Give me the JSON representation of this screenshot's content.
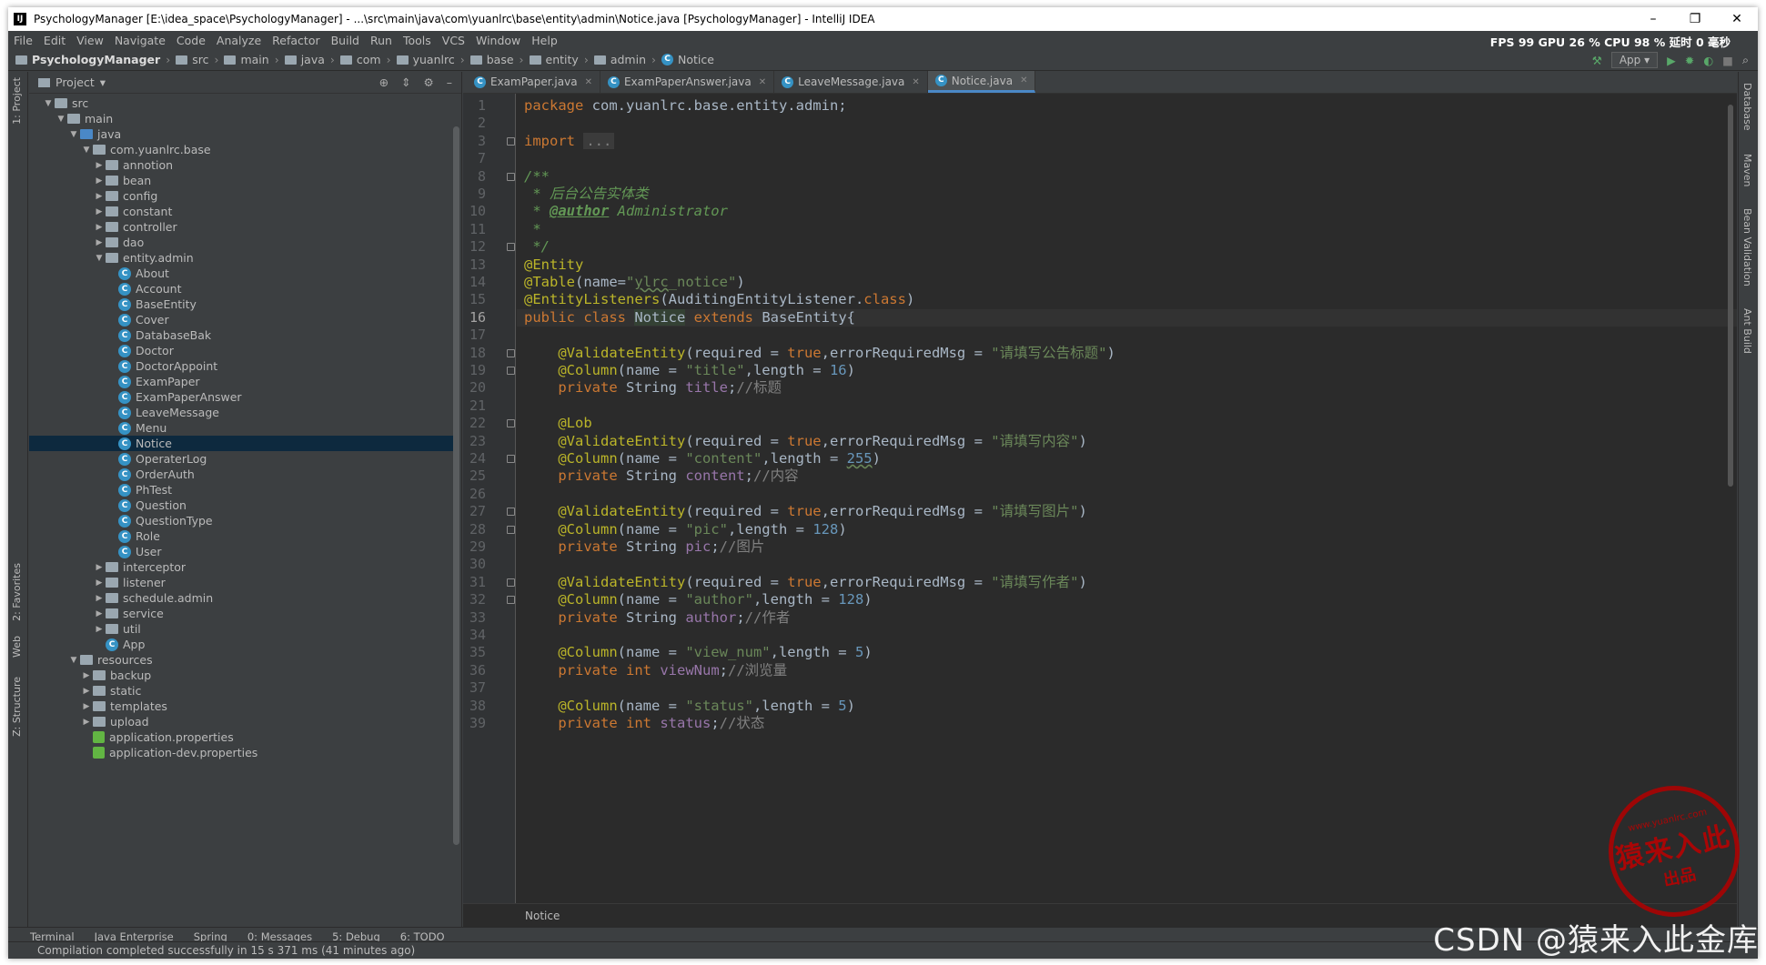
{
  "window": {
    "title": "PsychologyManager [E:\\idea_space\\PsychologyManager] - ...\\src\\main\\java\\com\\yuanlrc\\base\\entity\\admin\\Notice.java [PsychologyManager] - IntelliJ IDEA",
    "minimize": "–",
    "maximize": "❐",
    "close": "✕"
  },
  "menu": [
    "File",
    "Edit",
    "View",
    "Navigate",
    "Code",
    "Analyze",
    "Refactor",
    "Build",
    "Run",
    "Tools",
    "VCS",
    "Window",
    "Help"
  ],
  "perf": "FPS  99   GPU  26 %  CPU  98 %  延时  0 毫秒",
  "breadcrumb": [
    "PsychologyManager",
    "src",
    "main",
    "java",
    "com",
    "yuanlrc",
    "base",
    "entity",
    "admin",
    "Notice"
  ],
  "run_config": "App",
  "left_tools": [
    "1: Project",
    "2: Favorites",
    "Web",
    "Z: Structure"
  ],
  "right_tools": [
    "Database",
    "Maven",
    "Bean Validation",
    "Ant Build"
  ],
  "project_panel": {
    "title": "Project",
    "tree": [
      {
        "label": "src",
        "depth": 1,
        "kind": "folder",
        "open": true
      },
      {
        "label": "main",
        "depth": 2,
        "kind": "folder",
        "open": true
      },
      {
        "label": "java",
        "depth": 3,
        "kind": "blue",
        "open": true
      },
      {
        "label": "com.yuanlrc.base",
        "depth": 4,
        "kind": "folder",
        "open": true
      },
      {
        "label": "annotion",
        "depth": 5,
        "kind": "folder",
        "open": false
      },
      {
        "label": "bean",
        "depth": 5,
        "kind": "folder",
        "open": false
      },
      {
        "label": "config",
        "depth": 5,
        "kind": "folder",
        "open": false
      },
      {
        "label": "constant",
        "depth": 5,
        "kind": "folder",
        "open": false
      },
      {
        "label": "controller",
        "depth": 5,
        "kind": "folder",
        "open": false
      },
      {
        "label": "dao",
        "depth": 5,
        "kind": "folder",
        "open": false
      },
      {
        "label": "entity.admin",
        "depth": 5,
        "kind": "folder",
        "open": true
      },
      {
        "label": "About",
        "depth": 6,
        "kind": "class"
      },
      {
        "label": "Account",
        "depth": 6,
        "kind": "class"
      },
      {
        "label": "BaseEntity",
        "depth": 6,
        "kind": "class"
      },
      {
        "label": "Cover",
        "depth": 6,
        "kind": "class"
      },
      {
        "label": "DatabaseBak",
        "depth": 6,
        "kind": "class"
      },
      {
        "label": "Doctor",
        "depth": 6,
        "kind": "class"
      },
      {
        "label": "DoctorAppoint",
        "depth": 6,
        "kind": "class"
      },
      {
        "label": "ExamPaper",
        "depth": 6,
        "kind": "class"
      },
      {
        "label": "ExamPaperAnswer",
        "depth": 6,
        "kind": "class"
      },
      {
        "label": "LeaveMessage",
        "depth": 6,
        "kind": "class"
      },
      {
        "label": "Menu",
        "depth": 6,
        "kind": "class"
      },
      {
        "label": "Notice",
        "depth": 6,
        "kind": "class",
        "selected": true
      },
      {
        "label": "OperaterLog",
        "depth": 6,
        "kind": "class"
      },
      {
        "label": "OrderAuth",
        "depth": 6,
        "kind": "class"
      },
      {
        "label": "PhTest",
        "depth": 6,
        "kind": "class"
      },
      {
        "label": "Question",
        "depth": 6,
        "kind": "class"
      },
      {
        "label": "QuestionType",
        "depth": 6,
        "kind": "class"
      },
      {
        "label": "Role",
        "depth": 6,
        "kind": "class"
      },
      {
        "label": "User",
        "depth": 6,
        "kind": "class"
      },
      {
        "label": "interceptor",
        "depth": 5,
        "kind": "folder",
        "open": false
      },
      {
        "label": "listener",
        "depth": 5,
        "kind": "folder",
        "open": false
      },
      {
        "label": "schedule.admin",
        "depth": 5,
        "kind": "folder",
        "open": false
      },
      {
        "label": "service",
        "depth": 5,
        "kind": "folder",
        "open": false
      },
      {
        "label": "util",
        "depth": 5,
        "kind": "folder",
        "open": false
      },
      {
        "label": "App",
        "depth": 5,
        "kind": "class"
      },
      {
        "label": "resources",
        "depth": 3,
        "kind": "folder",
        "open": true
      },
      {
        "label": "backup",
        "depth": 4,
        "kind": "folder",
        "open": false
      },
      {
        "label": "static",
        "depth": 4,
        "kind": "folder",
        "open": false
      },
      {
        "label": "templates",
        "depth": 4,
        "kind": "folder",
        "open": false
      },
      {
        "label": "upload",
        "depth": 4,
        "kind": "folder",
        "open": false
      },
      {
        "label": "application.properties",
        "depth": 4,
        "kind": "prop"
      },
      {
        "label": "application-dev.properties",
        "depth": 4,
        "kind": "prop"
      }
    ]
  },
  "tabs": [
    {
      "label": "ExamPaper.java",
      "active": false
    },
    {
      "label": "ExamPaperAnswer.java",
      "active": false
    },
    {
      "label": "LeaveMessage.java",
      "active": false
    },
    {
      "label": "Notice.java",
      "active": true
    }
  ],
  "code_lines": [
    {
      "n": "1",
      "html": "<span class='kw'>package</span> com.yuanlrc.base.entity.admin;"
    },
    {
      "n": "2",
      "html": ""
    },
    {
      "n": "3",
      "html": "<span class='kw'>import</span> <span class='dots'>...</span>",
      "fold": true
    },
    {
      "n": "7",
      "html": ""
    },
    {
      "n": "8",
      "html": "<span class='cm'>/**</span>",
      "fold": true
    },
    {
      "n": "9",
      "html": "<span class='cm'> * 后台公告实体类</span>"
    },
    {
      "n": "10",
      "html": "<span class='cm'> * <span class='tag'>@author</span> Administrator</span>"
    },
    {
      "n": "11",
      "html": "<span class='cm'> *</span>"
    },
    {
      "n": "12",
      "html": "<span class='cm'> */</span>",
      "fold": true
    },
    {
      "n": "13",
      "html": "<span class='an'>@Entity</span>"
    },
    {
      "n": "14",
      "html": "<span class='an'>@Table</span>(name=<span class='st'>\"<span class='sq'>ylrc</span>_notice\"</span>)"
    },
    {
      "n": "15",
      "html": "<span class='an'>@EntityListeners</span>(AuditingEntityListener.<span class='kw'>class</span>)"
    },
    {
      "n": "16",
      "html": "<span class='kw'>public class</span> <span class='hl'>Notice</span> <span class='kw'>extends</span> BaseEntity{",
      "current": true
    },
    {
      "n": "17",
      "html": ""
    },
    {
      "n": "18",
      "html": "    <span class='an'>@ValidateEntity</span>(required = <span class='kw'>true</span>,errorRequiredMsg = <span class='st'>\"请填写公告标题\"</span>)",
      "fold": true
    },
    {
      "n": "19",
      "html": "    <span class='an'>@Column</span>(name = <span class='st'>\"title\"</span>,length = <span class='nm'>16</span>)",
      "fold": true
    },
    {
      "n": "20",
      "html": "    <span class='kw'>private</span> String <span class='fd'>title</span>;<span class='cg'>//标题</span>"
    },
    {
      "n": "21",
      "html": ""
    },
    {
      "n": "22",
      "html": "    <span class='an'>@Lob</span>",
      "fold": true
    },
    {
      "n": "23",
      "html": "    <span class='an'>@ValidateEntity</span>(required = <span class='kw'>true</span>,errorRequiredMsg = <span class='st'>\"请填写内容\"</span>)"
    },
    {
      "n": "24",
      "html": "    <span class='an'>@Column</span>(name = <span class='st'>\"content\"</span>,length = <span class='nm sq'>255</span>)",
      "fold": true
    },
    {
      "n": "25",
      "html": "    <span class='kw'>private</span> String <span class='fd'>content</span>;<span class='cg'>//内容</span>"
    },
    {
      "n": "26",
      "html": ""
    },
    {
      "n": "27",
      "html": "    <span class='an'>@ValidateEntity</span>(required = <span class='kw'>true</span>,errorRequiredMsg = <span class='st'>\"请填写图片\"</span>)",
      "fold": true
    },
    {
      "n": "28",
      "html": "    <span class='an'>@Column</span>(name = <span class='st'>\"pic\"</span>,length = <span class='nm'>128</span>)",
      "fold": true
    },
    {
      "n": "29",
      "html": "    <span class='kw'>private</span> String <span class='fd'>pic</span>;<span class='cg'>//图片</span>"
    },
    {
      "n": "30",
      "html": ""
    },
    {
      "n": "31",
      "html": "    <span class='an'>@ValidateEntity</span>(required = <span class='kw'>true</span>,errorRequiredMsg = <span class='st'>\"请填写作者\"</span>)",
      "fold": true
    },
    {
      "n": "32",
      "html": "    <span class='an'>@Column</span>(name = <span class='st'>\"author\"</span>,length = <span class='nm'>128</span>)",
      "fold": true
    },
    {
      "n": "33",
      "html": "    <span class='kw'>private</span> String <span class='fd'>author</span>;<span class='cg'>//作者</span>"
    },
    {
      "n": "34",
      "html": ""
    },
    {
      "n": "35",
      "html": "    <span class='an'>@Column</span>(name = <span class='st'>\"view_num\"</span>,length = <span class='nm'>5</span>)"
    },
    {
      "n": "36",
      "html": "    <span class='kw'>private int</span> <span class='fd'>viewNum</span>;<span class='cg'>//浏览量</span>"
    },
    {
      "n": "37",
      "html": ""
    },
    {
      "n": "38",
      "html": "    <span class='an'>@Column</span>(name = <span class='st'>\"status\"</span>,length = <span class='nm'>5</span>)"
    },
    {
      "n": "39",
      "html": "    <span class='kw'>private int</span> <span class='fd'>status</span>;<span class='cg'>//状态</span>"
    }
  ],
  "editor_breadcrumb": "Notice",
  "tool_windows": [
    "Terminal",
    "Java Enterprise",
    "Spring",
    "0: Messages",
    "5: Debug",
    "6: TODO"
  ],
  "status": "Compilation completed successfully in 15 s 371 ms (41 minutes ago)",
  "stamp": {
    "top": "www.yuanlrc.com",
    "mid": "猿来入此",
    "bottom": "出品"
  },
  "watermark": "CSDN @猿来入此金库"
}
